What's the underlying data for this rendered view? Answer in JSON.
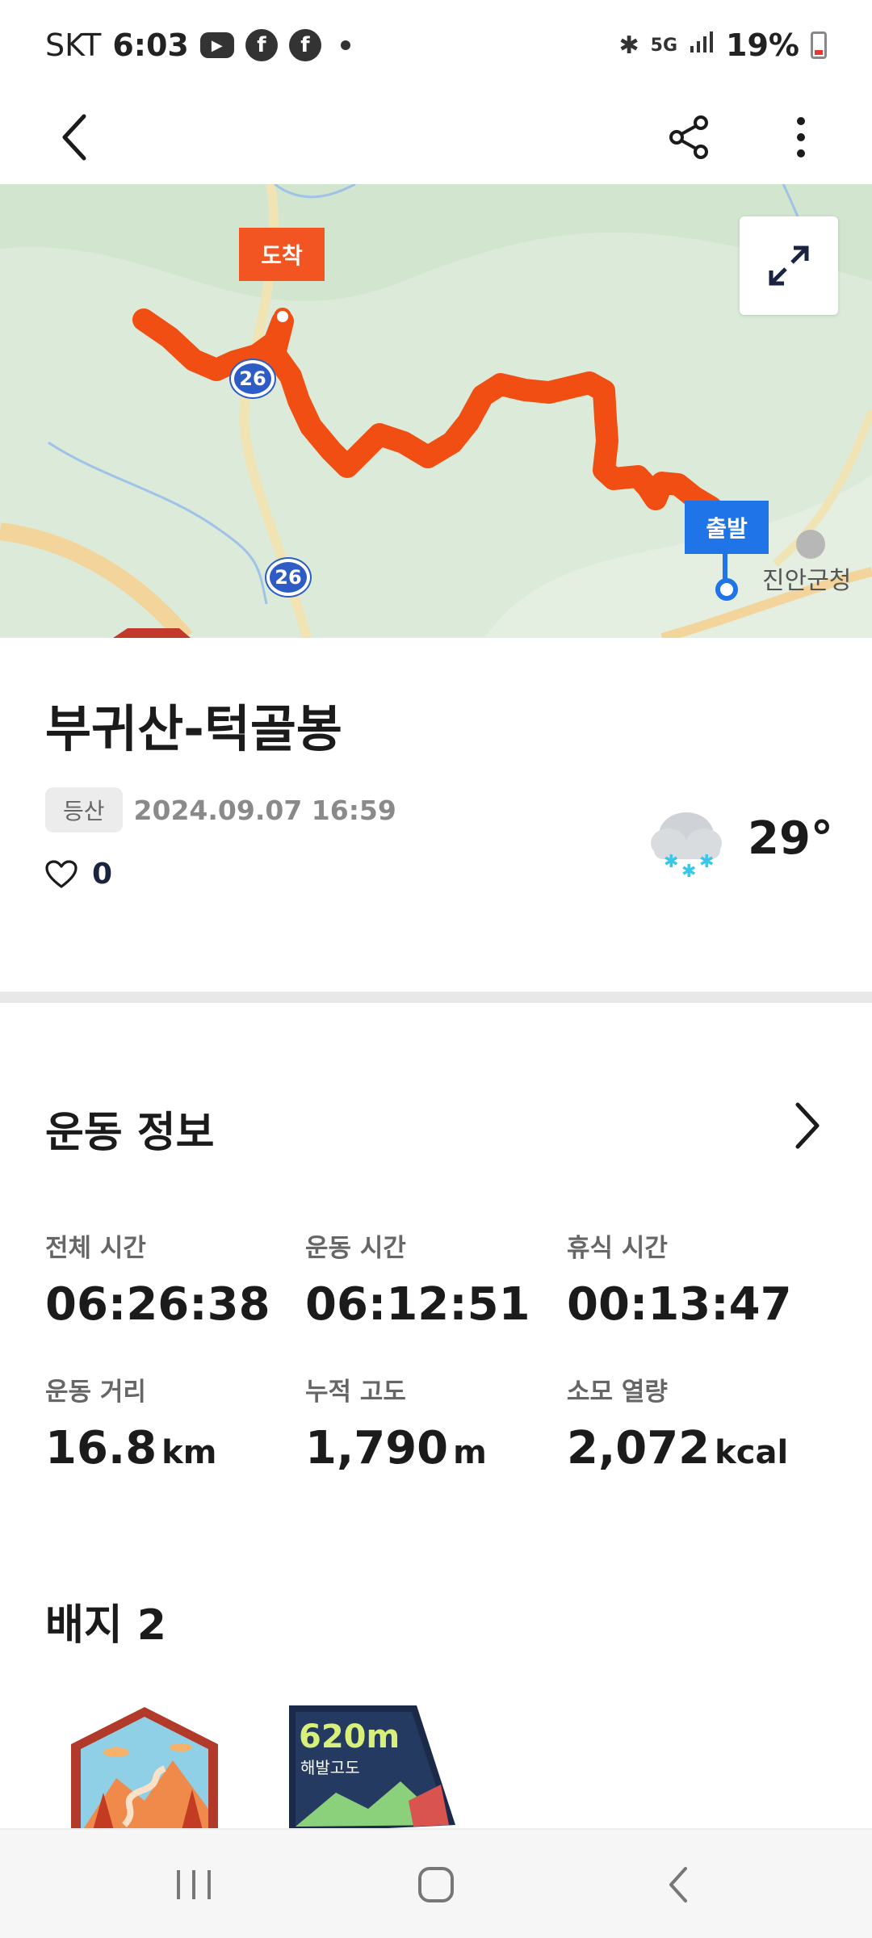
{
  "status_bar": {
    "carrier": "SKT",
    "time": "6:03",
    "notification_icons": [
      "youtube-icon",
      "facebook-icon",
      "facebook-icon"
    ],
    "network": "5G",
    "battery": "19%"
  },
  "map": {
    "arrive_label": "도착",
    "depart_label": "출발",
    "place_label": "진안군청",
    "road_number_1": "26",
    "road_number_2": "26",
    "route_color": "#f04e12"
  },
  "activity": {
    "title": "부귀산-턱골봉",
    "category": "등산",
    "date": "2024.09.07 16:59",
    "likes": "0",
    "temperature": "29°",
    "weather_icon": "cloud-snow-icon"
  },
  "exercise": {
    "section_title": "운동 정보",
    "stats": [
      {
        "label": "전체 시간",
        "value": "06:26:38",
        "unit": ""
      },
      {
        "label": "운동 시간",
        "value": "06:12:51",
        "unit": ""
      },
      {
        "label": "휴식 시간",
        "value": "00:13:47",
        "unit": ""
      },
      {
        "label": "운동 거리",
        "value": "16.8",
        "unit": "km"
      },
      {
        "label": "누적 고도",
        "value": "1,790",
        "unit": "m"
      },
      {
        "label": "소모 열량",
        "value": "2,072",
        "unit": "kcal"
      }
    ]
  },
  "badges": {
    "section_title": "배지 2",
    "badge_2_text_main": "620m",
    "badge_2_text_sub": "해발고도"
  },
  "colors": {
    "accent_orange": "#f25522",
    "accent_blue": "#1f74e8",
    "text_dark": "#1b1b1b"
  }
}
